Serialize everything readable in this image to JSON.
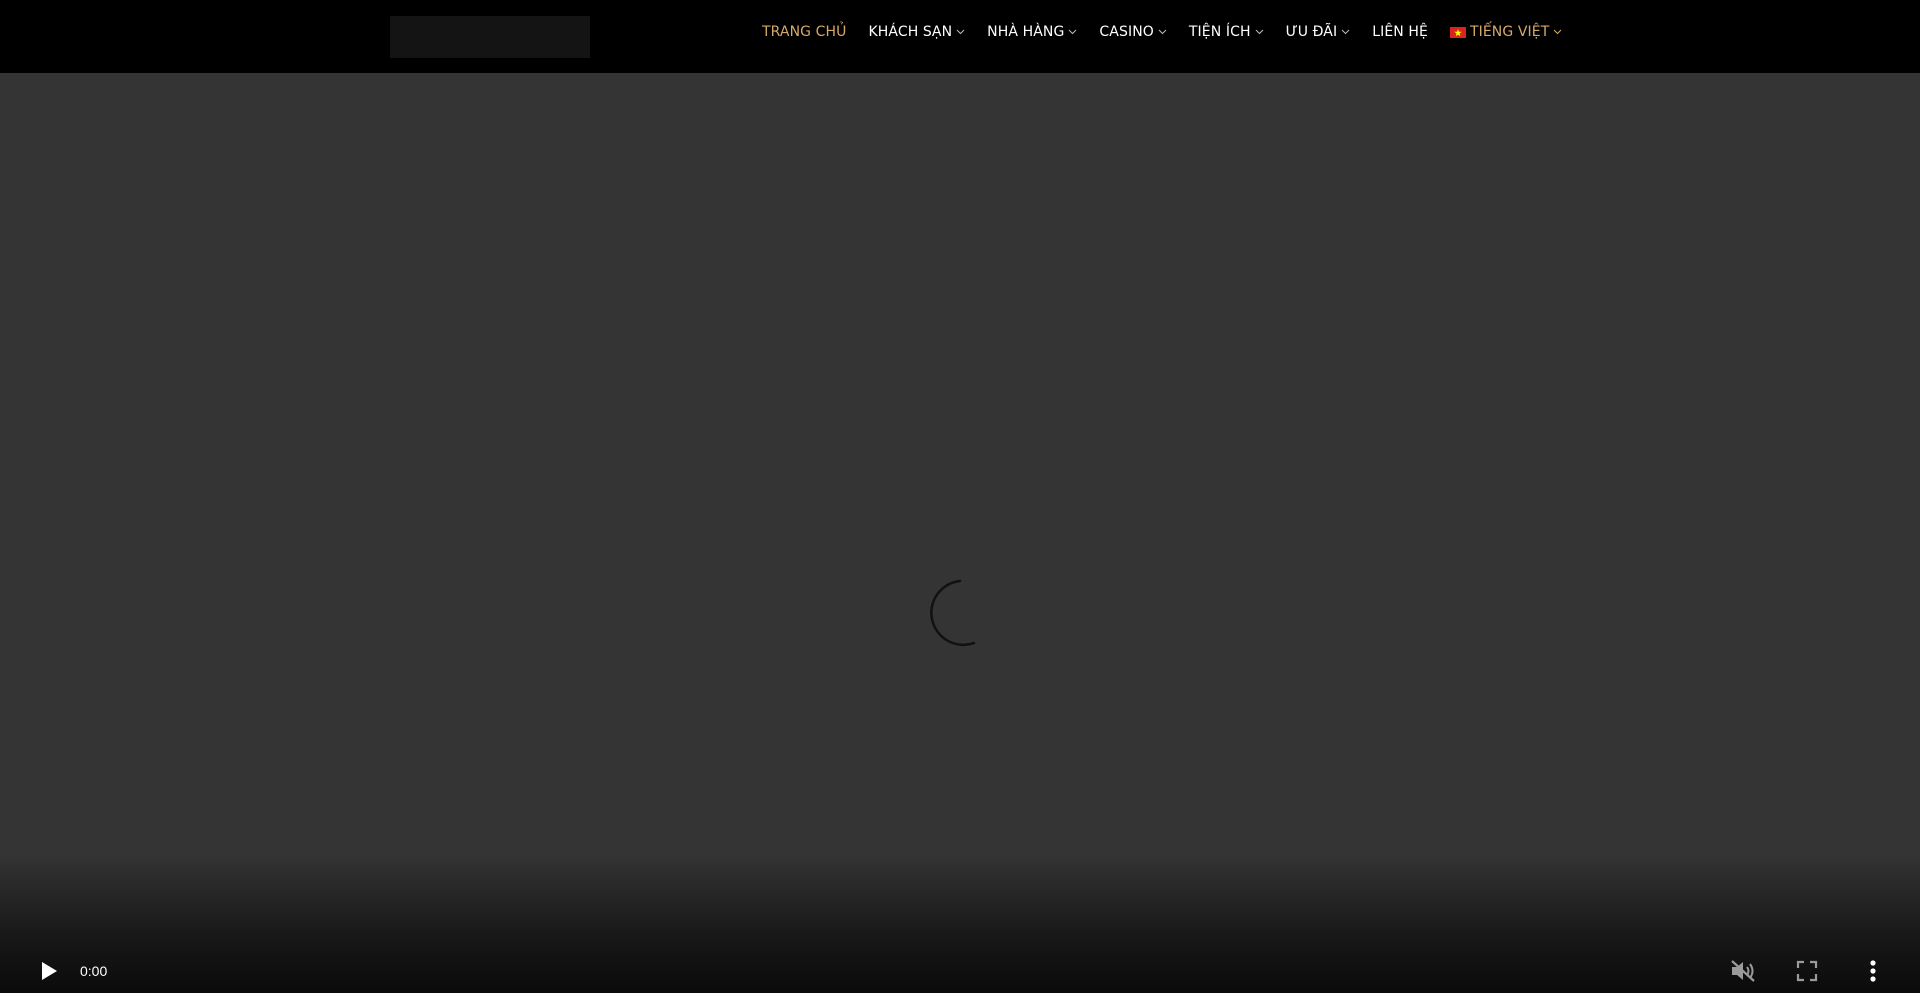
{
  "header": {
    "nav": [
      {
        "label": "TRANG CHỦ",
        "active": true,
        "dropdown": false
      },
      {
        "label": "KHÁCH SẠN",
        "active": false,
        "dropdown": true
      },
      {
        "label": "NHÀ HÀNG",
        "active": false,
        "dropdown": true
      },
      {
        "label": "CASINO",
        "active": false,
        "dropdown": true
      },
      {
        "label": "TIỆN ÍCH",
        "active": false,
        "dropdown": true
      },
      {
        "label": "ƯU ĐÃI",
        "active": false,
        "dropdown": true
      },
      {
        "label": "LIÊN HỆ",
        "active": false,
        "dropdown": false
      }
    ],
    "language": {
      "label": "TIẾNG VIỆT",
      "flag_icon": "vietnam-flag-icon"
    }
  },
  "video": {
    "time": "0:00",
    "muted": true,
    "loading": true
  },
  "colors": {
    "accent": "#d6a969",
    "header_bg": "#000000",
    "video_bg": "#343434"
  }
}
